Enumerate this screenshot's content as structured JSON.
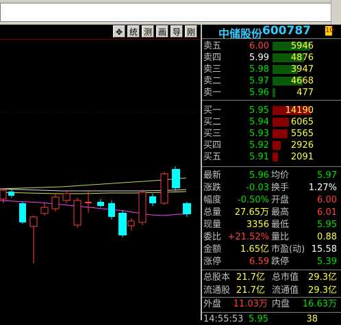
{
  "stock": {
    "name": "中储股份",
    "code": "600787",
    "f10_label": "10"
  },
  "toolbar": {
    "buttons": [
      {
        "name": "move-button",
        "label": "✥"
      },
      {
        "name": "tong-button",
        "label": "统"
      },
      {
        "name": "ce-button",
        "label": "测"
      },
      {
        "name": "hua-button",
        "label": "画"
      },
      {
        "name": "dao-button",
        "label": "导"
      },
      {
        "name": "ze-button",
        "label": "刚"
      }
    ]
  },
  "sell_orders": [
    {
      "label": "卖五",
      "price": "6.00",
      "volume": "5946",
      "color": "red"
    },
    {
      "label": "卖四",
      "price": "5.99",
      "volume": "4876",
      "color": "white"
    },
    {
      "label": "卖三",
      "price": "5.98",
      "volume": "3947",
      "color": "green"
    },
    {
      "label": "卖二",
      "price": "5.97",
      "volume": "4668",
      "color": "green"
    },
    {
      "label": "卖一",
      "price": "5.96",
      "volume": "477",
      "color": "green"
    }
  ],
  "buy_orders": [
    {
      "label": "买一",
      "price": "5.95",
      "volume": "14190",
      "color": "green"
    },
    {
      "label": "买二",
      "price": "5.94",
      "volume": "6065",
      "color": "green"
    },
    {
      "label": "买三",
      "price": "5.93",
      "volume": "5565",
      "color": "green"
    },
    {
      "label": "买四",
      "price": "5.92",
      "volume": "2926",
      "color": "green"
    },
    {
      "label": "买五",
      "price": "5.91",
      "volume": "2091",
      "color": "green"
    }
  ],
  "quote": [
    {
      "l1": "最新",
      "v1": "5.96",
      "c1": "green",
      "l2": "均价",
      "v2": "5.97",
      "c2": "green"
    },
    {
      "l1": "涨跌",
      "v1": "-0.03",
      "c1": "green",
      "l2": "换手",
      "v2": "1.27%",
      "c2": "white"
    },
    {
      "l1": "幅度",
      "v1": "-0.50%",
      "c1": "green",
      "l2": "开盘",
      "v2": "6.00",
      "c2": "red"
    },
    {
      "l1": "总量",
      "v1": "27.65万",
      "c1": "yellow",
      "l2": "最高",
      "v2": "6.01",
      "c2": "red"
    },
    {
      "l1": "现量",
      "v1": "3356",
      "c1": "yellow",
      "l2": "最低",
      "v2": "5.95",
      "c2": "green"
    },
    {
      "l1": "委比",
      "v1": "+21.52%",
      "c1": "red",
      "l2": "量比",
      "v2": "0.88",
      "c2": "yellow"
    },
    {
      "l1": "金额",
      "v1": "1.65亿",
      "c1": "yellow",
      "l2": "市盈(动)",
      "v2": "15.58",
      "c2": "white"
    },
    {
      "l1": "涨停",
      "v1": "6.59",
      "c1": "red",
      "l2": "跌停",
      "v2": "5.39",
      "c2": "green"
    }
  ],
  "capital": [
    {
      "l1": "总股本",
      "v1": "21.7亿",
      "l2": "总市值",
      "v2": "29.3亿"
    },
    {
      "l1": "流通股",
      "v1": "21.7亿",
      "l2": "流通值",
      "v2": "29.3亿"
    }
  ],
  "outer_inner": {
    "l1": "外盘",
    "v1": "11.03万",
    "l2": "内盘",
    "v2": "16.63万"
  },
  "tick": {
    "time": "14:55:53",
    "price": "5.95",
    "volume": "38"
  },
  "colors": {
    "red": "#ff4040",
    "green": "#00e000",
    "yellow": "#ffff40",
    "white": "#ffffff",
    "cyan": "#33ccff"
  }
}
